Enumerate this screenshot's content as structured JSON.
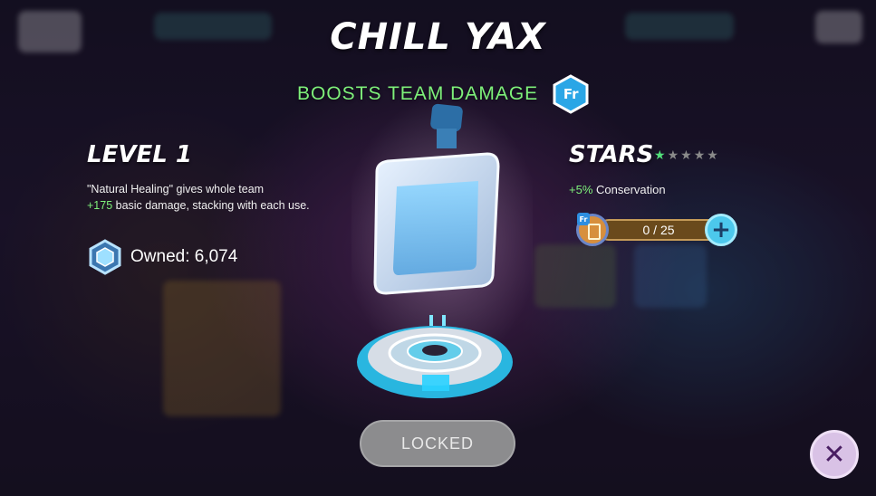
{
  "header": {
    "title": "CHILL YAX",
    "subtitle": "BOOSTS TEAM DAMAGE",
    "badge": "Fr"
  },
  "level": {
    "label": "LEVEL 1",
    "desc_part1": "\"Natural Healing\" gives whole team",
    "desc_bonus": "+175",
    "desc_part2": " basic damage, stacking with each use.",
    "owned": "Owned: 6,074",
    "owned_icon": "crystal-currency-icon"
  },
  "stars": {
    "label": "STARS",
    "filled": 1,
    "total": 5,
    "stat_bonus": "+5%",
    "stat_name": " Conservation"
  },
  "progress": {
    "text": "0 / 25",
    "value": 0,
    "max": 25,
    "mini_badge": "Fr"
  },
  "buttons": {
    "locked": "LOCKED"
  },
  "colors": {
    "accent_green": "#7ef07a",
    "badge_blue": "#2aa6e6",
    "progress_fill": "#e7a436"
  }
}
